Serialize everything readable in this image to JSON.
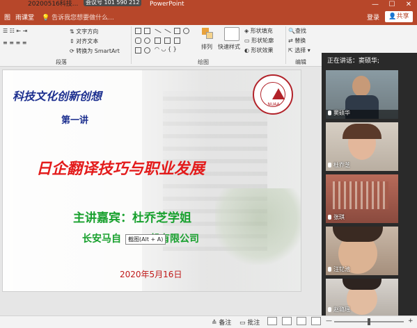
{
  "titlebar": {
    "title": "20200516科技...",
    "meeting_id": "会议号 101 590 212",
    "app": "PowerPoint",
    "minimize": "—",
    "maximize": "☐",
    "close": "✕"
  },
  "tabs": {
    "file": "图",
    "classroom": "雨课堂",
    "tell_me": "告诉我您想要做什么...",
    "login": "登录",
    "share": "共享"
  },
  "ribbon": {
    "paragraph_group": {
      "label": "段落",
      "text_direction": "文字方向",
      "align_text": "对齐文本",
      "convert_smartart": "转换为 SmartArt"
    },
    "drawing_group": {
      "label": "绘图",
      "arrange": "排列",
      "quick_styles": "快速样式",
      "shape_fill": "形状填充",
      "shape_outline": "形状轮廓",
      "shape_effects": "形状效果"
    },
    "editing_group": {
      "label": "编辑",
      "find": "查找",
      "replace": "替换",
      "select": "选择"
    }
  },
  "slide": {
    "series_title": "科技文化创新创想",
    "lecture_no": "第一讲",
    "main_title": "日企翻译技巧与职业发展",
    "guest": "主讲嘉宾：杜乔芝学姐",
    "company": "长安马自",
    "company_tail": "机有限公司",
    "date": "2020年5月16日",
    "logo_text": "NUAA",
    "tooltip": "截图(Alt + A)"
  },
  "status": {
    "notes": "备注",
    "comments": "批注",
    "zoom_minus": "—",
    "zoom_plus": "+"
  },
  "meeting_panel": {
    "speaking_label": "正在讲话：窦硕华;",
    "participants": [
      {
        "name": "窦硕华"
      },
      {
        "name": "杜乔芝"
      },
      {
        "name": "张琪"
      },
      {
        "name": "汪钇池"
      },
      {
        "name": "赵璐瑶"
      }
    ]
  }
}
